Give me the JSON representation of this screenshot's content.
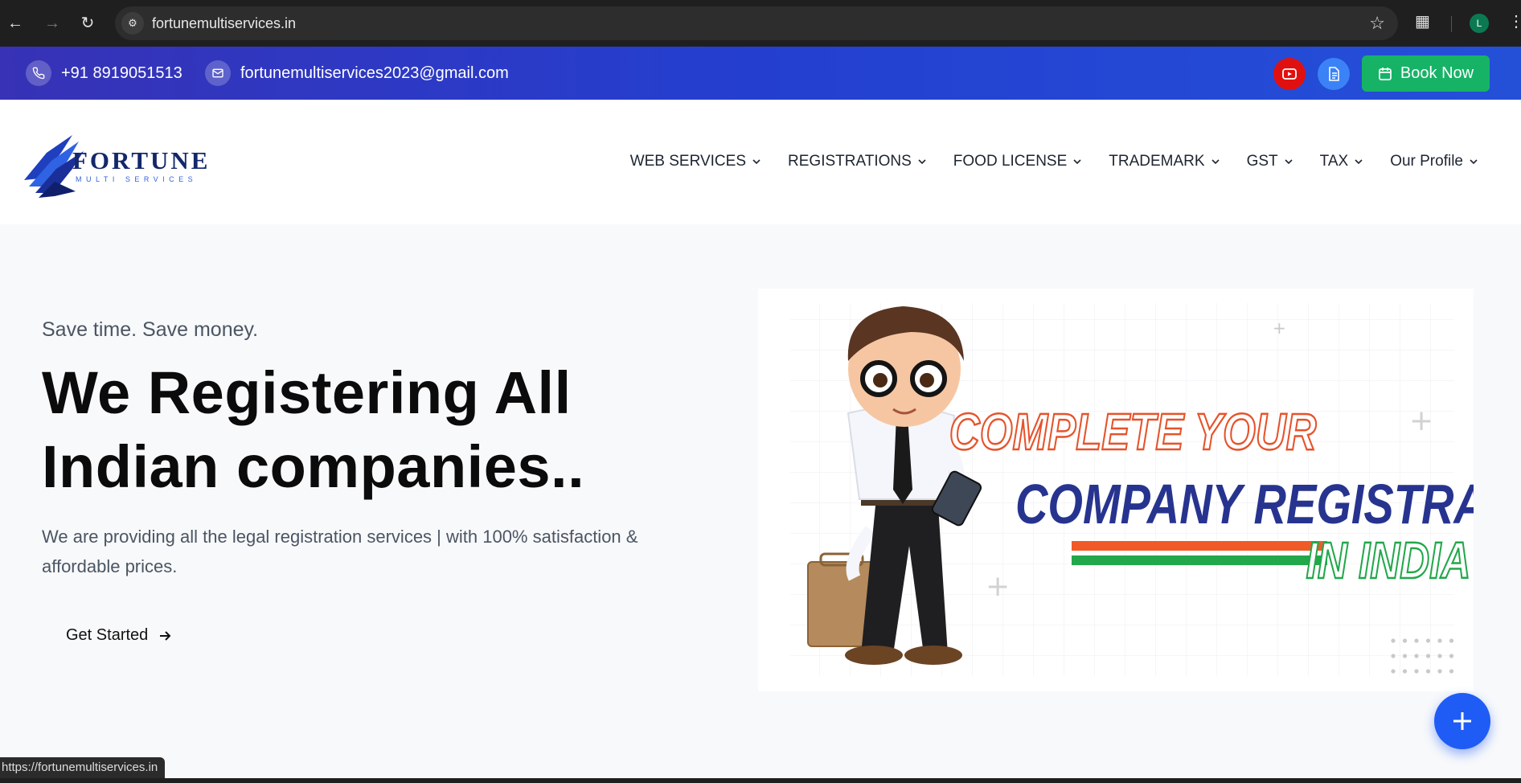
{
  "browser": {
    "url": "fortunemultiservices.in",
    "profile_initial": "L",
    "status_url": "https://fortunemultiservices.in"
  },
  "topbar": {
    "phone": "+91 8919051513",
    "email": "fortunemultiservices2023@gmail.com",
    "book_label": "Book Now"
  },
  "logo": {
    "name": "FORTUNE",
    "sub": "MULTI SERVICES"
  },
  "nav": {
    "items": [
      {
        "label": "WEB SERVICES"
      },
      {
        "label": "REGISTRATIONS"
      },
      {
        "label": "FOOD LICENSE"
      },
      {
        "label": "TRADEMARK"
      },
      {
        "label": "GST"
      },
      {
        "label": "TAX"
      },
      {
        "label": "Our Profile"
      }
    ]
  },
  "hero": {
    "tagline": "Save time. Save money.",
    "heading_line1": "We Registering All",
    "heading_line2": "Indian companies..",
    "description": "We are providing all the legal registration services | with 100% satisfaction & affordable prices.",
    "cta_label": "Get Started",
    "banner_line1": "COMPLETE YOUR",
    "banner_line2": "COMPANY REGISTRATION",
    "banner_line3": "IN INDIA"
  },
  "colors": {
    "topbar_start": "#3732b6",
    "topbar_end": "#2450d8",
    "book_green": "#16b366",
    "fab_blue": "#1f5cf5",
    "youtube_red": "#e11010"
  }
}
